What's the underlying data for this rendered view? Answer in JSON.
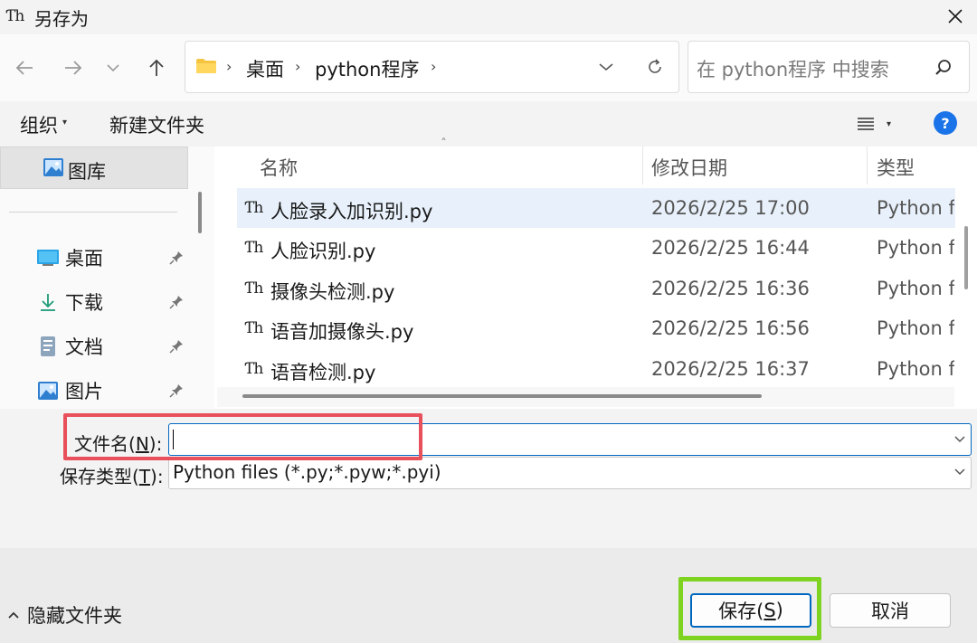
{
  "window": {
    "title": "另存为",
    "app_icon": "Ƭh"
  },
  "address": {
    "crumbs": [
      "桌面",
      "python程序"
    ]
  },
  "search": {
    "placeholder": "在 python程序 中搜索"
  },
  "commands": {
    "organize": "组织",
    "new_folder": "新建文件夹"
  },
  "sidebar": {
    "gallery": "图库",
    "items": [
      {
        "label": "桌面",
        "icon": "desktop-icon"
      },
      {
        "label": "下载",
        "icon": "download-icon"
      },
      {
        "label": "文档",
        "icon": "document-icon"
      },
      {
        "label": "图片",
        "icon": "pictures-icon"
      }
    ]
  },
  "columns": {
    "name": "名称",
    "date": "修改日期",
    "type": "类型"
  },
  "files": [
    {
      "name": "人脸录入加识别.py",
      "date": "2026/2/25 17:00",
      "type": "Python f",
      "selected": true
    },
    {
      "name": "人脸识别.py",
      "date": "2026/2/25 16:44",
      "type": "Python f"
    },
    {
      "name": "摄像头检测.py",
      "date": "2026/2/25 16:36",
      "type": "Python f"
    },
    {
      "name": "语音加摄像头.py",
      "date": "2026/2/25 16:56",
      "type": "Python f"
    },
    {
      "name": "语音检测.py",
      "date": "2026/2/25 16:37",
      "type": "Python f"
    }
  ],
  "form": {
    "filename_label_pre": "文件名(",
    "filename_label_key": "N",
    "filename_label_post": "):",
    "filename_value": "",
    "filetype_label_pre": "保存类型(",
    "filetype_label_key": "T",
    "filetype_label_post": "):",
    "filetype_value": "Python files (*.py;*.pyw;*.pyi)"
  },
  "footer": {
    "hide_folders": "隐藏文件夹",
    "save_pre": "保存(",
    "save_key": "S",
    "save_post": ")",
    "cancel": "取消"
  },
  "colors": {
    "accent": "#0067c0",
    "highlight_red": "#e8505b",
    "highlight_green": "#7ed321",
    "selection": "#e8f1fb"
  }
}
